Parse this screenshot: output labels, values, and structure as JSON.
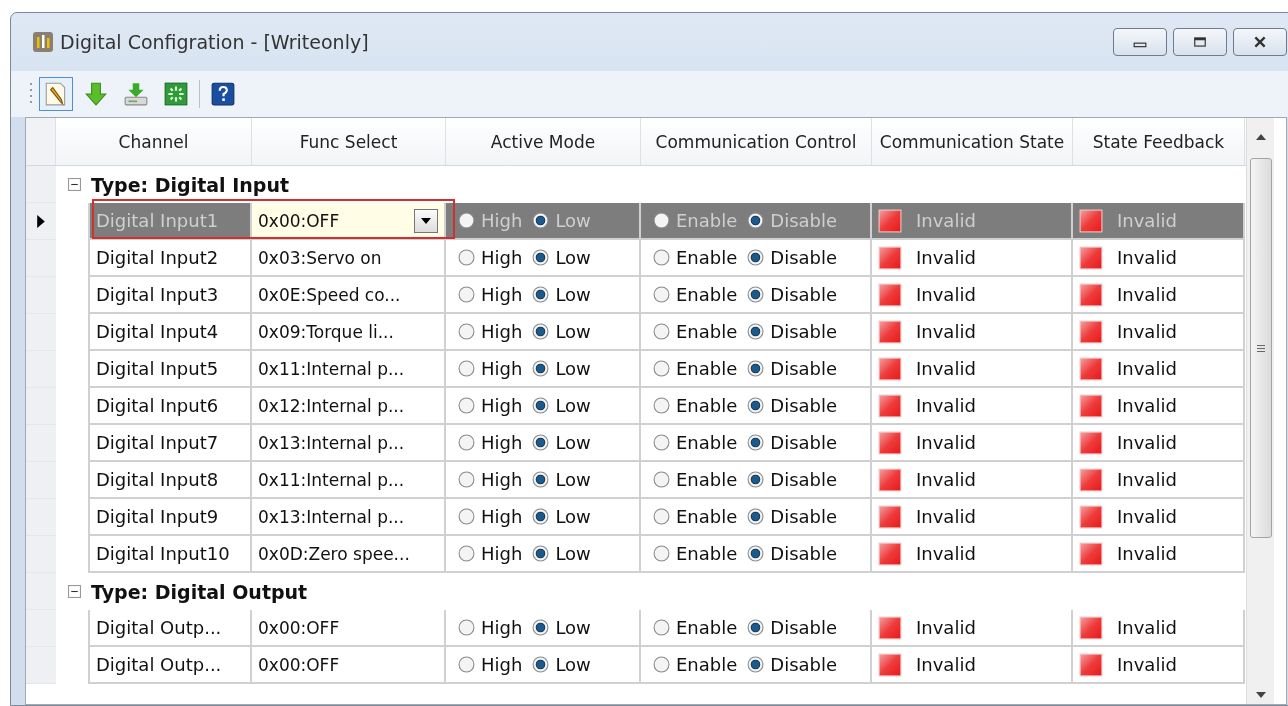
{
  "window": {
    "title": "Digital Configration - [Writeonly]"
  },
  "toolbar": [
    {
      "kind": "edit",
      "selected": true
    },
    {
      "kind": "download",
      "selected": false
    },
    {
      "kind": "save",
      "selected": false
    },
    {
      "kind": "refresh",
      "selected": false
    },
    {
      "kind": "separator"
    },
    {
      "kind": "help",
      "selected": false
    }
  ],
  "table": {
    "columns": [
      "Channel",
      "Func Select",
      "Active Mode",
      "Communication Control",
      "Communication State",
      "State Feedback"
    ],
    "groups": [
      {
        "label": "Type: Digital Input",
        "expanded": true,
        "rows": [
          {
            "channel": "Digital Input1",
            "func": "0x00:OFF",
            "selected": true,
            "editing": true,
            "highlighted": true,
            "active_mode": [
              {
                "label": "High",
                "selected": false
              },
              {
                "label": "Low",
                "selected": true
              }
            ],
            "communication_control": [
              {
                "label": "Enable",
                "selected": false
              },
              {
                "label": "Disable",
                "selected": true
              }
            ],
            "communication_state": "Invalid",
            "state_feedback": "Invalid"
          },
          {
            "channel": "Digital Input2",
            "func": "0x03:Servo on",
            "selected": false,
            "editing": false,
            "highlighted": false,
            "active_mode": [
              {
                "label": "High",
                "selected": false
              },
              {
                "label": "Low",
                "selected": true
              }
            ],
            "communication_control": [
              {
                "label": "Enable",
                "selected": false
              },
              {
                "label": "Disable",
                "selected": true
              }
            ],
            "communication_state": "Invalid",
            "state_feedback": "Invalid"
          },
          {
            "channel": "Digital Input3",
            "func": "0x0E:Speed co...",
            "selected": false,
            "editing": false,
            "highlighted": false,
            "active_mode": [
              {
                "label": "High",
                "selected": false
              },
              {
                "label": "Low",
                "selected": true
              }
            ],
            "communication_control": [
              {
                "label": "Enable",
                "selected": false
              },
              {
                "label": "Disable",
                "selected": true
              }
            ],
            "communication_state": "Invalid",
            "state_feedback": "Invalid"
          },
          {
            "channel": "Digital Input4",
            "func": "0x09:Torque li...",
            "selected": false,
            "editing": false,
            "highlighted": false,
            "active_mode": [
              {
                "label": "High",
                "selected": false
              },
              {
                "label": "Low",
                "selected": true
              }
            ],
            "communication_control": [
              {
                "label": "Enable",
                "selected": false
              },
              {
                "label": "Disable",
                "selected": true
              }
            ],
            "communication_state": "Invalid",
            "state_feedback": "Invalid"
          },
          {
            "channel": "Digital Input5",
            "func": "0x11:Internal p...",
            "selected": false,
            "editing": false,
            "highlighted": false,
            "active_mode": [
              {
                "label": "High",
                "selected": false
              },
              {
                "label": "Low",
                "selected": true
              }
            ],
            "communication_control": [
              {
                "label": "Enable",
                "selected": false
              },
              {
                "label": "Disable",
                "selected": true
              }
            ],
            "communication_state": "Invalid",
            "state_feedback": "Invalid"
          },
          {
            "channel": "Digital Input6",
            "func": "0x12:Internal p...",
            "selected": false,
            "editing": false,
            "highlighted": false,
            "active_mode": [
              {
                "label": "High",
                "selected": false
              },
              {
                "label": "Low",
                "selected": true
              }
            ],
            "communication_control": [
              {
                "label": "Enable",
                "selected": false
              },
              {
                "label": "Disable",
                "selected": true
              }
            ],
            "communication_state": "Invalid",
            "state_feedback": "Invalid"
          },
          {
            "channel": "Digital Input7",
            "func": "0x13:Internal p...",
            "selected": false,
            "editing": false,
            "highlighted": false,
            "active_mode": [
              {
                "label": "High",
                "selected": false
              },
              {
                "label": "Low",
                "selected": true
              }
            ],
            "communication_control": [
              {
                "label": "Enable",
                "selected": false
              },
              {
                "label": "Disable",
                "selected": true
              }
            ],
            "communication_state": "Invalid",
            "state_feedback": "Invalid"
          },
          {
            "channel": "Digital Input8",
            "func": "0x11:Internal p...",
            "selected": false,
            "editing": false,
            "highlighted": false,
            "active_mode": [
              {
                "label": "High",
                "selected": false
              },
              {
                "label": "Low",
                "selected": true
              }
            ],
            "communication_control": [
              {
                "label": "Enable",
                "selected": false
              },
              {
                "label": "Disable",
                "selected": true
              }
            ],
            "communication_state": "Invalid",
            "state_feedback": "Invalid"
          },
          {
            "channel": "Digital Input9",
            "func": "0x13:Internal p...",
            "selected": false,
            "editing": false,
            "highlighted": false,
            "active_mode": [
              {
                "label": "High",
                "selected": false
              },
              {
                "label": "Low",
                "selected": true
              }
            ],
            "communication_control": [
              {
                "label": "Enable",
                "selected": false
              },
              {
                "label": "Disable",
                "selected": true
              }
            ],
            "communication_state": "Invalid",
            "state_feedback": "Invalid"
          },
          {
            "channel": "Digital Input10",
            "func": "0x0D:Zero spee...",
            "selected": false,
            "editing": false,
            "highlighted": false,
            "active_mode": [
              {
                "label": "High",
                "selected": false
              },
              {
                "label": "Low",
                "selected": true
              }
            ],
            "communication_control": [
              {
                "label": "Enable",
                "selected": false
              },
              {
                "label": "Disable",
                "selected": true
              }
            ],
            "communication_state": "Invalid",
            "state_feedback": "Invalid"
          }
        ]
      },
      {
        "label": "Type: Digital Output",
        "expanded": true,
        "rows": [
          {
            "channel": "Digital Outp...",
            "func": "0x00:OFF",
            "selected": false,
            "editing": false,
            "highlighted": false,
            "active_mode": [
              {
                "label": "High",
                "selected": false
              },
              {
                "label": "Low",
                "selected": true
              }
            ],
            "communication_control": [
              {
                "label": "Enable",
                "selected": false
              },
              {
                "label": "Disable",
                "selected": true
              }
            ],
            "communication_state": "Invalid",
            "state_feedback": "Invalid"
          },
          {
            "channel": "Digital Outp...",
            "func": "0x00:OFF",
            "selected": false,
            "editing": false,
            "highlighted": false,
            "active_mode": [
              {
                "label": "High",
                "selected": false
              },
              {
                "label": "Low",
                "selected": true
              }
            ],
            "communication_control": [
              {
                "label": "Enable",
                "selected": false
              },
              {
                "label": "Disable",
                "selected": true
              }
            ],
            "communication_state": "Invalid",
            "state_feedback": "Invalid"
          }
        ]
      }
    ]
  }
}
